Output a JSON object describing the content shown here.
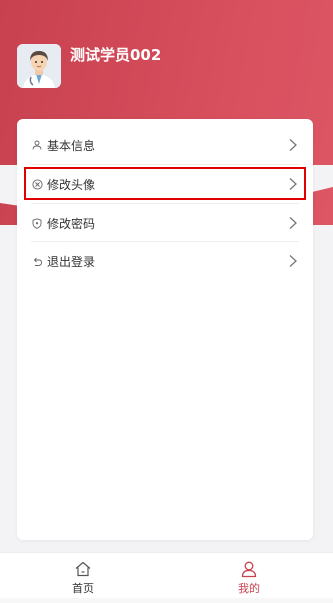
{
  "header": {
    "username": "测试学员002",
    "brand_color": "#d34957"
  },
  "menu": {
    "items": [
      {
        "label": "基本信息",
        "icon": "user-icon"
      },
      {
        "label": "修改头像",
        "icon": "avatar-edit-icon",
        "highlighted": true
      },
      {
        "label": "修改密码",
        "icon": "shield-icon"
      },
      {
        "label": "退出登录",
        "icon": "logout-icon"
      }
    ]
  },
  "tabbar": {
    "tabs": [
      {
        "label": "首页",
        "icon": "home-icon",
        "active": false
      },
      {
        "label": "我的",
        "icon": "profile-icon",
        "active": true
      }
    ],
    "active_color": "#c8414f"
  }
}
